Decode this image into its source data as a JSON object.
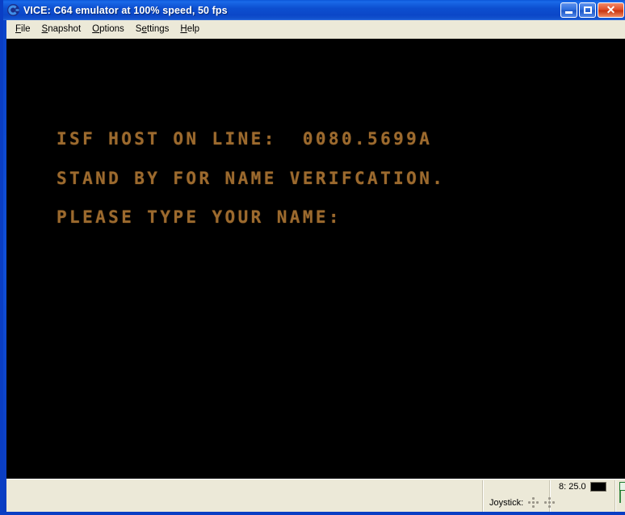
{
  "window": {
    "title": "VICE: C64 emulator at 100% speed, 50 fps",
    "app_icon": "vice-logo-icon",
    "controls": {
      "minimize": "_",
      "maximize": "□",
      "close": "✕"
    }
  },
  "menubar": {
    "items": [
      {
        "label": "File",
        "accel": "F"
      },
      {
        "label": "Snapshot",
        "accel": "S"
      },
      {
        "label": "Options",
        "accel": "O"
      },
      {
        "label": "Settings",
        "accel": "S"
      },
      {
        "label": "Help",
        "accel": "H"
      }
    ]
  },
  "screen": {
    "background": "#000000",
    "text_color": "#9c6a2e",
    "lines": [
      "ISF HOST ON LINE:  0080.5699A",
      "STAND BY FOR NAME VERIFCATION.",
      "PLEASE TYPE YOUR NAME:"
    ]
  },
  "statusbar": {
    "joystick_label": "Joystick:",
    "drive_label": "8: 25.0",
    "drive_led_color": "#000000",
    "tape_icon": "tape-counter-icon"
  }
}
